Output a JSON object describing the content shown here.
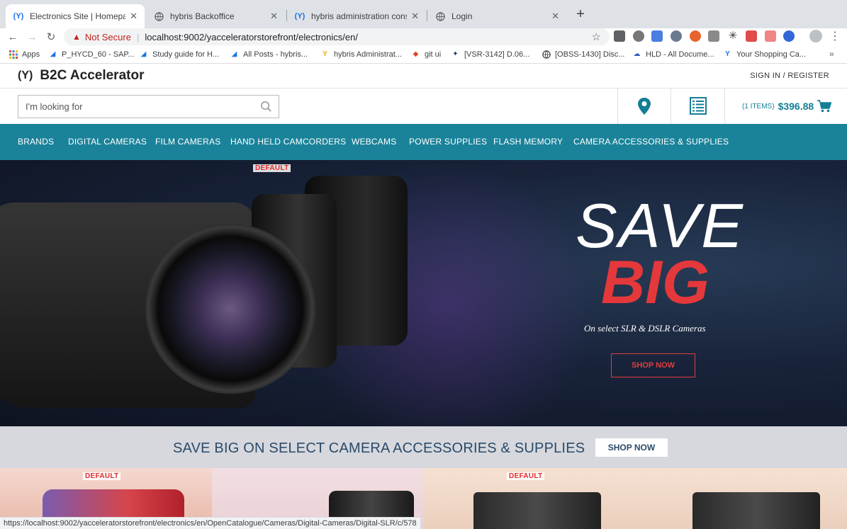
{
  "browser": {
    "tabs": [
      {
        "title": "Electronics Site | Homepage",
        "icon": "hybris-icon",
        "active": true
      },
      {
        "title": "hybris Backoffice",
        "icon": "globe-icon",
        "active": false
      },
      {
        "title": "hybris administration console |",
        "icon": "hybris-icon",
        "active": false
      },
      {
        "title": "Login",
        "icon": "globe-icon",
        "active": false
      }
    ],
    "address": {
      "security_label": "Not Secure",
      "url": "localhost:9002/yacceleratorstorefront/electronics/en/"
    },
    "bookmarks": [
      {
        "label": "Apps",
        "icon": "apps-grid-icon"
      },
      {
        "label": "P_HYCD_60 - SAP...",
        "icon": "sap-icon"
      },
      {
        "label": "Study guide for H...",
        "icon": "sap-icon"
      },
      {
        "label": "All Posts - hybris...",
        "icon": "sap-icon"
      },
      {
        "label": "hybris Administrat...",
        "icon": "hybris-icon"
      },
      {
        "label": "git ui",
        "icon": "gitlab-icon"
      },
      {
        "label": "[VSR-3142] D.06...",
        "icon": "jira-icon"
      },
      {
        "label": "[OBSS-1430] Disc...",
        "icon": "globe-icon"
      },
      {
        "label": "HLD - All Docume...",
        "icon": "confluence-icon"
      },
      {
        "label": "Your Shopping Ca...",
        "icon": "hybris-icon"
      }
    ],
    "status_url": "https://localhost:9002/yacceleratorstorefront/electronics/en/OpenCatalogue/Cameras/Digital-Cameras/Digital-SLR/c/578"
  },
  "site": {
    "logo_text": "B2C Accelerator",
    "sign_in": "SIGN IN / REGISTER",
    "search_placeholder": "I'm looking for",
    "cart": {
      "items": "(1 ITEMS)",
      "total": "$396.88"
    },
    "nav": [
      "BRANDS",
      "DIGITAL CAMERAS",
      "FILM CAMERAS",
      "HAND HELD CAMCORDERS",
      "WEBCAMS",
      "POWER SUPPLIES",
      "FLASH MEMORY",
      "CAMERA ACCESSORIES & SUPPLIES"
    ],
    "hero": {
      "badge": "DEFAULT",
      "headline_1": "SAVE",
      "headline_2": "BIG",
      "subline": "On select SLR & DSLR Cameras",
      "cta": "SHOP NOW"
    },
    "promo": {
      "text": "SAVE BIG ON SELECT CAMERA ACCESSORIES & SUPPLIES",
      "cta": "SHOP NOW"
    },
    "tile_badges": [
      "DEFAULT",
      "DEFAULT"
    ]
  },
  "colors": {
    "accent": "#1a839a",
    "cart": "#157e96",
    "sale_red": "#e5383b",
    "promo_text": "#2a4a6a"
  }
}
